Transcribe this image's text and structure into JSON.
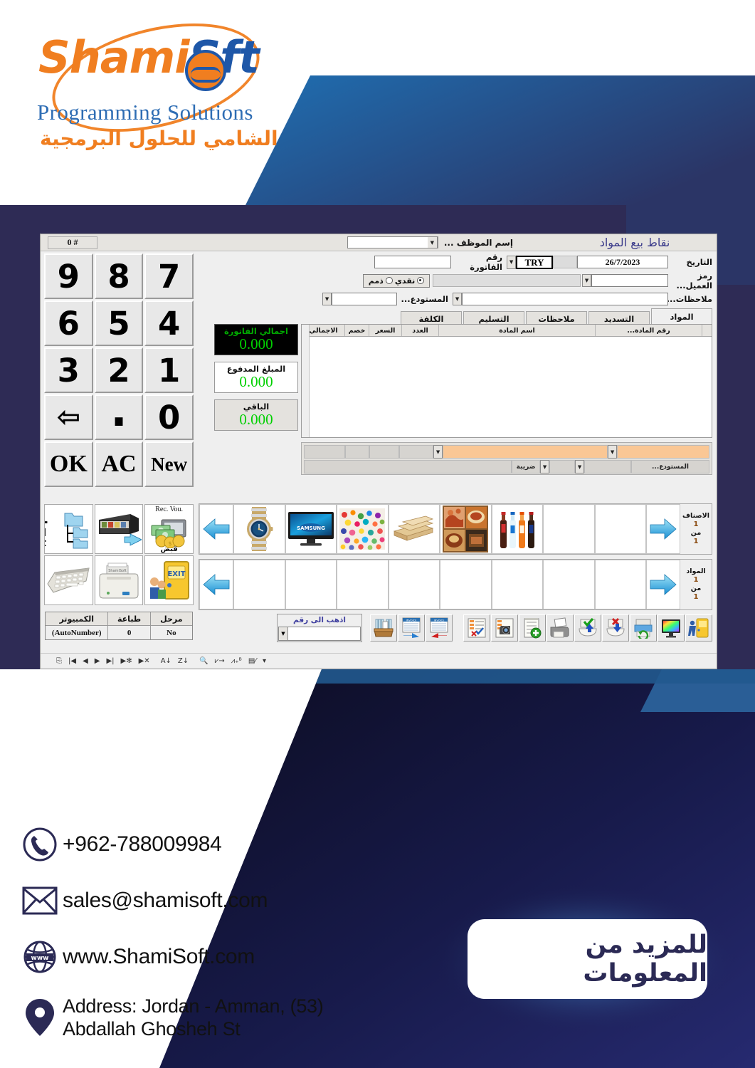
{
  "brand": {
    "name_part1": "Shami",
    "name_part2": "S",
    "name_part3": "ft",
    "tagline_en": "Programming Solutions",
    "tagline_ar": "الشامي للحلول البرمجية",
    "accent_orange": "#F07E20",
    "accent_blue": "#1E57A8",
    "deep_navy": "#2A2850"
  },
  "pos": {
    "title": "نقاط بيع المواد",
    "employee_label": "إسم الموظف ...",
    "record_count": "# 0",
    "fields": {
      "date_label": "التاريخ",
      "date_value": "26/7/2023",
      "currency_value": "TRY",
      "invoice_no_label": "رقم الفاتورة",
      "invoice_no_value": "",
      "customer_code_label": "رمز العميل...",
      "customer_code_value": "",
      "notes_label": "ملاحظات...",
      "notes_value": "",
      "warehouse_label": "المستودع...",
      "warehouse_value": "",
      "payment_cash": "نقدي",
      "payment_credit": "ذمم",
      "payment_selected": "نقدي"
    },
    "tabs": [
      {
        "label": "المواد",
        "active": true
      },
      {
        "label": "التسديد",
        "active": false
      },
      {
        "label": "ملاحظات",
        "active": false
      },
      {
        "label": "التسليم",
        "active": false
      },
      {
        "label": "الكلفة",
        "active": false
      }
    ],
    "grid": {
      "columns": [
        "رقم المادة...",
        "اسم المادة",
        "العدد",
        "السعر",
        "خصم",
        "الاجمالي"
      ],
      "rows": []
    },
    "entry_row": {
      "tax_label": "ضريبة",
      "warehouse_label": "المستودع...",
      "highlight_color": "#FAC795"
    },
    "totals": [
      {
        "label": "اجمالي الفاتورة",
        "value": "0.000",
        "style": "dark"
      },
      {
        "label": "المبلغ المدفوع",
        "value": "0.000",
        "style": "white"
      },
      {
        "label": "الباقي",
        "value": "0.000",
        "style": "gray"
      }
    ],
    "keypad": [
      [
        "7",
        "8",
        "9"
      ],
      [
        "4",
        "5",
        "6"
      ],
      [
        "1",
        "2",
        "3"
      ],
      [
        "0",
        ".",
        "⇦"
      ],
      [
        "New",
        "AC",
        "OK"
      ]
    ],
    "categories_strip": {
      "pager_title": "الاصناف",
      "pager_current": "1",
      "pager_of": "من",
      "pager_total": "1",
      "items": [
        "watch",
        "samsung-tv",
        "candy",
        "wood",
        "food-platter",
        "soft-drinks",
        "",
        ""
      ]
    },
    "items_strip": {
      "pager_title": "المواد",
      "pager_current": "1",
      "pager_of": "من",
      "pager_total": "1",
      "items": [
        "",
        "",
        "",
        "",
        "",
        "",
        "",
        ""
      ]
    },
    "side_buttons": [
      {
        "name": "all-categories",
        "caption": "All Cat"
      },
      {
        "name": "cash-drawer",
        "caption": ""
      },
      {
        "name": "receipt-voucher",
        "caption": "Rec. Vou.",
        "caption_ar": "قبض"
      },
      {
        "name": "on-screen-keyboard",
        "caption": ""
      },
      {
        "name": "receipt-printer",
        "caption": ""
      },
      {
        "name": "exit-door",
        "caption": ""
      }
    ],
    "status_table": {
      "headers": [
        "مرحل",
        "طباعة",
        "الكمبيوتر"
      ],
      "values": [
        "No",
        "0",
        "(AutoNumber)"
      ]
    },
    "goto": {
      "label": "اذهب الى رقم",
      "value": ""
    },
    "toolbar_icons": [
      "exit-door-icon",
      "color-monitor-icon",
      "printer-refresh-icon",
      "delete-record-icon",
      "save-record-icon",
      "print-icon",
      "new-note-icon",
      "camera-edit-icon",
      "checklist-icon",
      "invoice-back-icon",
      "invoice-forward-icon",
      "archive-box-icon"
    ],
    "nav_buttons": [
      "record-exit",
      "first-record",
      "prev-record",
      "next-record",
      "last-record",
      "new-record",
      "delete-record",
      "sort-asc",
      "sort-desc",
      "find",
      "filter-by-selection",
      "filter-advanced",
      "apply-filter",
      "dropdown-more"
    ]
  },
  "contact": {
    "phone": "+962-788009984",
    "email": "sales@shamisoft.com",
    "website": "www.ShamiSoft.com",
    "address_line1": "Address: Jordan - Amman, (53)",
    "address_line2": "Abdallah Ghosheh St",
    "phone_icon": "phone-icon",
    "email_icon": "envelope-icon",
    "web_icon": "globe-icon",
    "address_icon": "map-pin-icon"
  },
  "cta": {
    "label": "للمزيد من المعلومات"
  }
}
